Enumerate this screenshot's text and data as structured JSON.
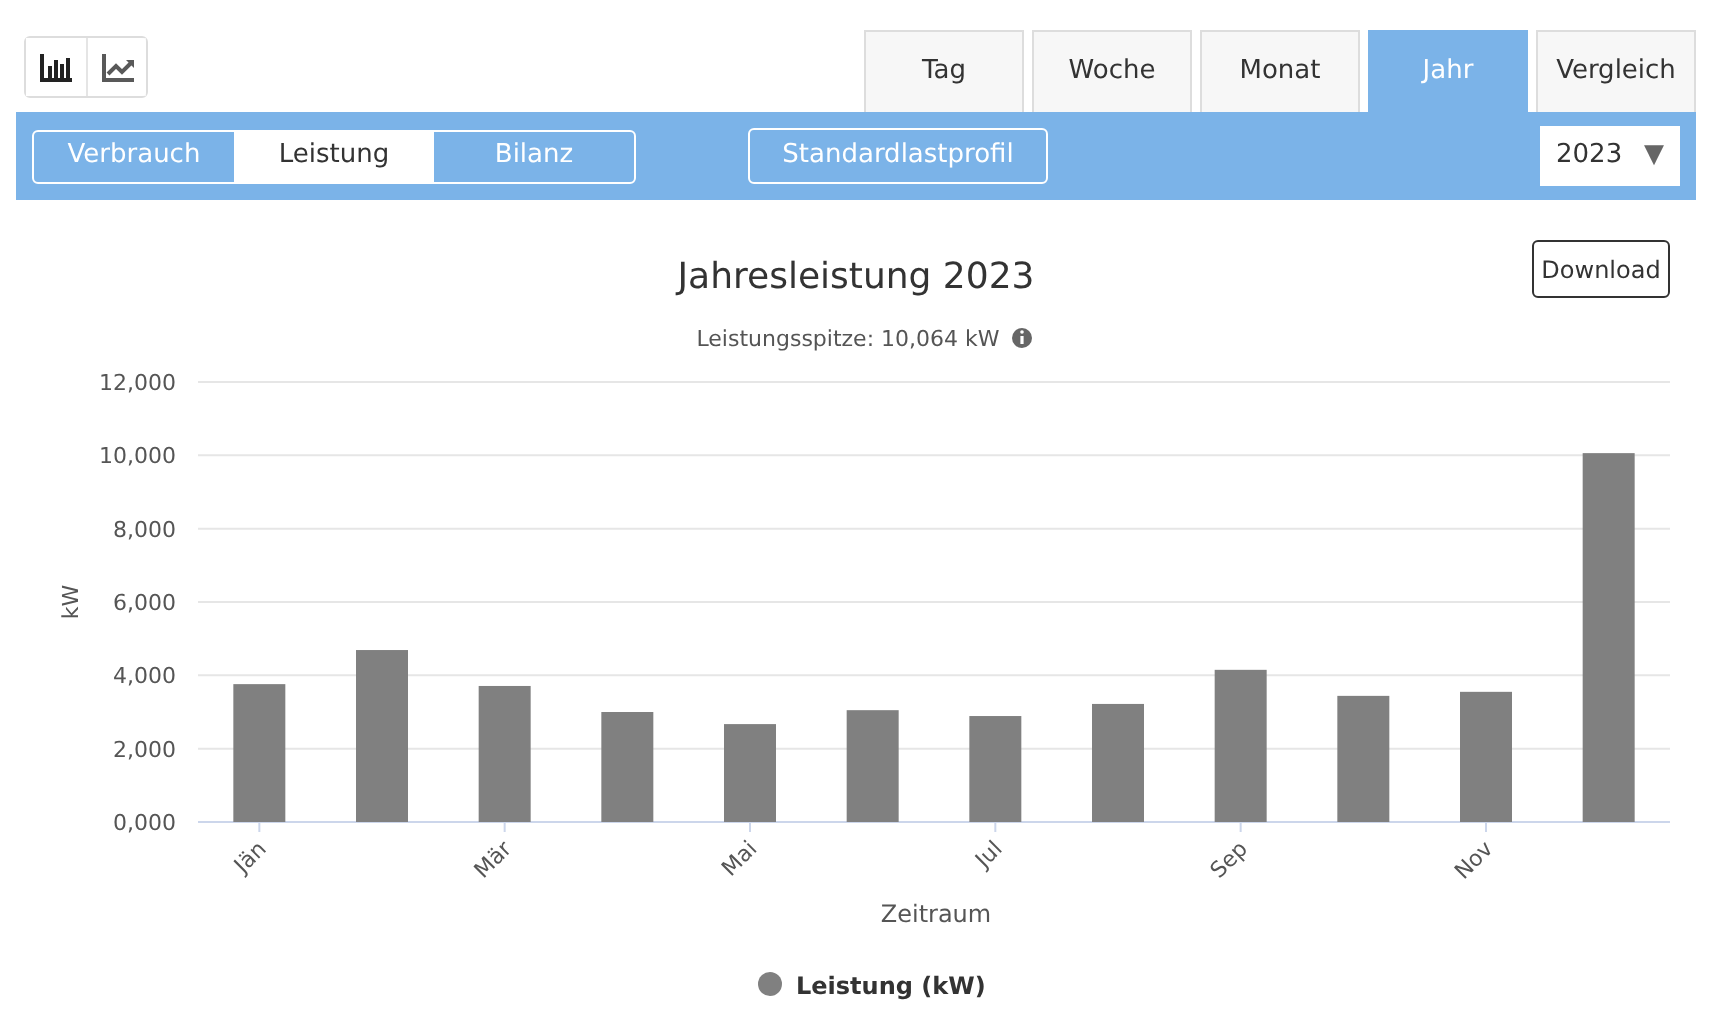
{
  "view_buttons": [
    {
      "kind": "bar",
      "selected": true
    },
    {
      "kind": "line",
      "selected": false
    }
  ],
  "tabs": [
    {
      "label": "Tag",
      "selected": false
    },
    {
      "label": "Woche",
      "selected": false
    },
    {
      "label": "Monat",
      "selected": false
    },
    {
      "label": "Jahr",
      "selected": true
    },
    {
      "label": "Vergleich",
      "selected": false
    }
  ],
  "segments": [
    {
      "label": "Verbrauch",
      "selected": false
    },
    {
      "label": "Leistung",
      "selected": true
    },
    {
      "label": "Bilanz",
      "selected": false
    }
  ],
  "profile_button": "Standardlastprofil",
  "year_select": {
    "value": "2023",
    "arrow": "▼"
  },
  "chart": {
    "download_button": "Download",
    "subtitle": "Leistungsspitze: 10,064 kW",
    "chart_data": {
      "type": "bar",
      "title": "Jahresleistung 2023",
      "xlabel": "Zeitraum",
      "ylabel": "kW",
      "categories": [
        "Jän",
        null,
        "Mär",
        null,
        "Mai",
        null,
        "Jul",
        null,
        "Sep",
        null,
        "Nov",
        null
      ],
      "series": [
        {
          "name": "Leistung (kW)",
          "color": "#808080",
          "values": [
            3760,
            4690,
            3710,
            3000,
            2670,
            3050,
            2890,
            3220,
            4150,
            3440,
            3550,
            10060
          ]
        }
      ],
      "ylim": [
        0,
        12000
      ],
      "grid": true,
      "yticks": [
        {
          "value": 0,
          "label": "0,000"
        },
        {
          "value": 2000,
          "label": "2,000"
        },
        {
          "value": 4000,
          "label": "4,000"
        },
        {
          "value": 6000,
          "label": "6,000"
        },
        {
          "value": 8000,
          "label": "8,000"
        },
        {
          "value": 10000,
          "label": "10,000"
        },
        {
          "value": 12000,
          "label": "12,000"
        }
      ]
    }
  }
}
